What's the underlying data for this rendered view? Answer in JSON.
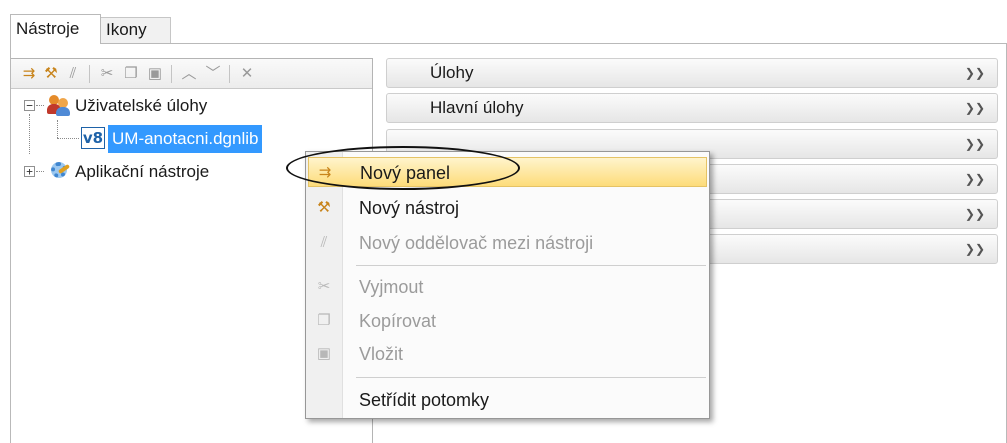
{
  "tabs": [
    {
      "label": "Nástroje",
      "active": true
    },
    {
      "label": "Ikony",
      "active": false
    }
  ],
  "toolbar": {
    "icons": [
      "new-panel-icon",
      "new-tool-icon",
      "new-separator-icon",
      "cut-icon",
      "copy-icon",
      "paste-icon",
      "move-up-icon",
      "move-down-icon",
      "delete-icon"
    ]
  },
  "tree": {
    "items": [
      {
        "label": "Uživatelské úlohy",
        "expander": "−",
        "icon": "users-icon"
      },
      {
        "label": "UM-anotacni.dgnlib",
        "icon": "v8-icon",
        "icon_text": "v8",
        "selected": true
      },
      {
        "label": "Aplikační nástroje",
        "expander": "+",
        "icon": "gear-icon"
      }
    ]
  },
  "accordion": {
    "items": [
      {
        "label": "Úlohy"
      },
      {
        "label": "Hlavní úlohy"
      },
      {
        "label": ""
      },
      {
        "label": ""
      },
      {
        "label": ""
      },
      {
        "label": ""
      }
    ]
  },
  "context_menu": {
    "items": [
      {
        "label": "Nový panel",
        "icon": "new-panel-icon",
        "state": "highlighted"
      },
      {
        "label": "Nový nástroj",
        "icon": "new-tool-icon",
        "state": "enabled"
      },
      {
        "label": "Nový oddělovač mezi nástroji",
        "icon": "new-separator-icon",
        "state": "disabled"
      },
      {
        "label": "Vyjmout",
        "icon": "cut-icon",
        "state": "disabled"
      },
      {
        "label": "Kopírovat",
        "icon": "copy-icon",
        "state": "disabled"
      },
      {
        "label": "Vložit",
        "icon": "paste-icon",
        "state": "disabled"
      },
      {
        "label": "Setřídit potomky",
        "icon": "",
        "state": "enabled"
      }
    ]
  },
  "colors": {
    "selection": "#3399ff",
    "menu_highlight": "#fddc7a",
    "accent_icon": "#c8841b"
  }
}
